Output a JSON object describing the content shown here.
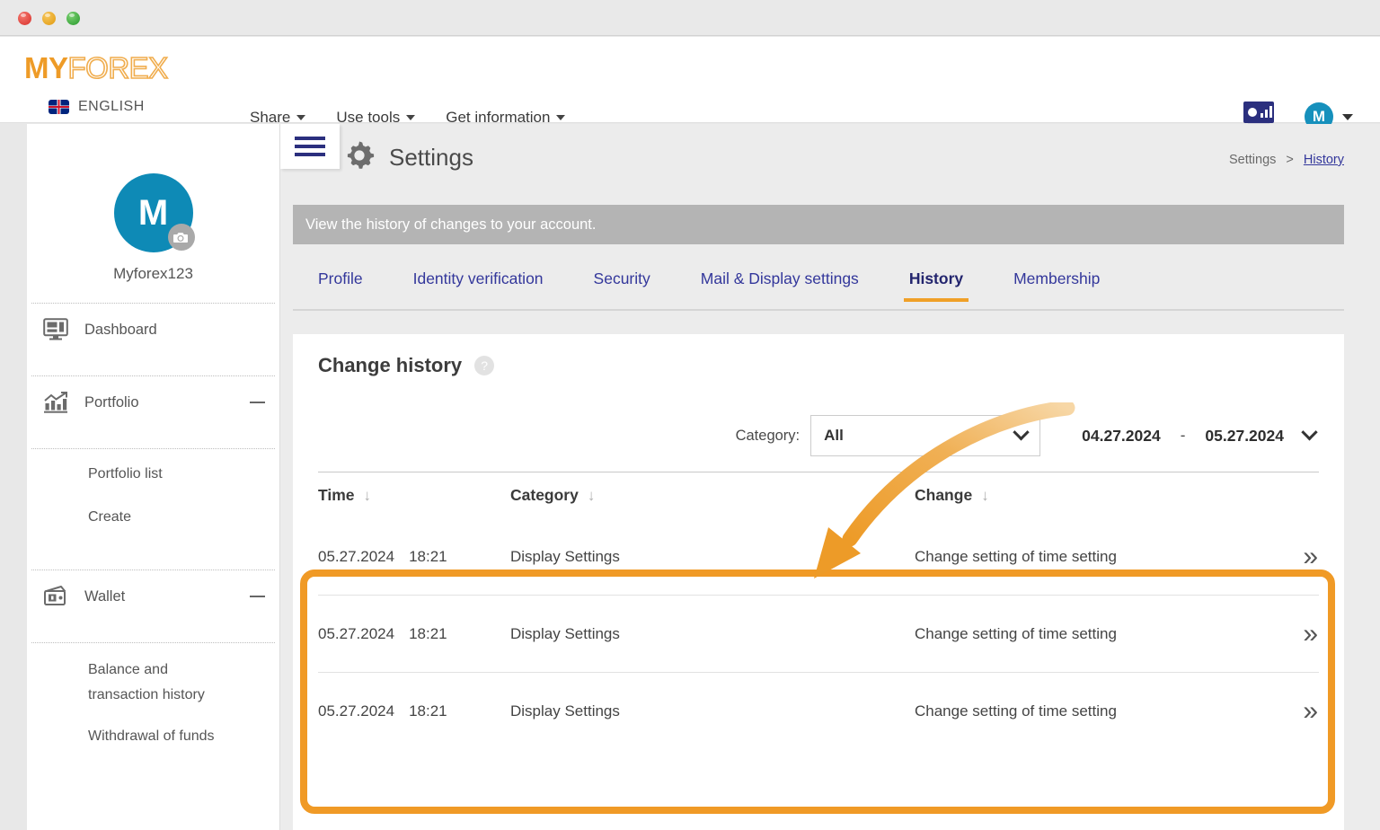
{
  "window": {
    "traffic_lights": [
      "close",
      "minimize",
      "maximize"
    ]
  },
  "topnav": {
    "logo_bold": "MY",
    "logo_light": "FOREX",
    "language": "ENGLISH",
    "menu": [
      {
        "label": "Share"
      },
      {
        "label": "Use tools"
      },
      {
        "label": "Get information"
      }
    ],
    "avatar_initial": "M"
  },
  "sidebar": {
    "avatar_initial": "M",
    "username": "Myforex123",
    "items": [
      {
        "label": "Dashboard",
        "icon": "monitor-icon",
        "collapsible": false
      },
      {
        "label": "Portfolio",
        "icon": "bar-chart-icon",
        "collapsible": true
      },
      {
        "label": "Wallet",
        "icon": "wallet-icon",
        "collapsible": true
      }
    ],
    "portfolio_sub": [
      "Portfolio list",
      "Create"
    ],
    "wallet_sub": [
      "Balance and transaction history",
      "Withdrawal of funds"
    ]
  },
  "header": {
    "title": "Settings",
    "icon": "gear-icon",
    "breadcrumb_parent": "Settings",
    "breadcrumb_sep": ">",
    "breadcrumb_current": "History"
  },
  "banner": {
    "text": "View the history of changes to your account."
  },
  "tabs": [
    {
      "label": "Profile",
      "active": false
    },
    {
      "label": "Identity verification",
      "active": false
    },
    {
      "label": "Security",
      "active": false
    },
    {
      "label": "Mail & Display settings",
      "active": false
    },
    {
      "label": "History",
      "active": true
    },
    {
      "label": "Membership",
      "active": false
    }
  ],
  "card": {
    "title": "Change history",
    "help_glyph": "?",
    "filter": {
      "category_label": "Category:",
      "category_value": "All",
      "date_from": "04.27.2024",
      "date_dash": "-",
      "date_to": "05.27.2024"
    },
    "table": {
      "columns": [
        {
          "label": "Time",
          "sort_glyph": "↓"
        },
        {
          "label": "Category",
          "sort_glyph": "↓"
        },
        {
          "label": "Change",
          "sort_glyph": "↓"
        }
      ],
      "rows": [
        {
          "date": "05.27.2024",
          "time": "18:21",
          "category": "Display Settings",
          "change": "Change setting of time setting",
          "go_glyph": "»"
        },
        {
          "date": "05.27.2024",
          "time": "18:21",
          "category": "Display Settings",
          "change": "Change setting of time setting",
          "go_glyph": "»"
        },
        {
          "date": "05.27.2024",
          "time": "18:21",
          "category": "Display Settings",
          "change": "Change setting of time setting",
          "go_glyph": "»"
        }
      ]
    }
  },
  "annotation": {
    "highlight_color": "#f09a26",
    "arrow_color": "#eda13a",
    "target": "change-history-table-rows"
  },
  "colors": {
    "brand_orange": "#ee9b27",
    "accent_orange": "#f0a028",
    "nav_indigo": "#33379b",
    "avatar_teal": "#0e8ab6",
    "banner_gray": "#b4b4b4"
  }
}
